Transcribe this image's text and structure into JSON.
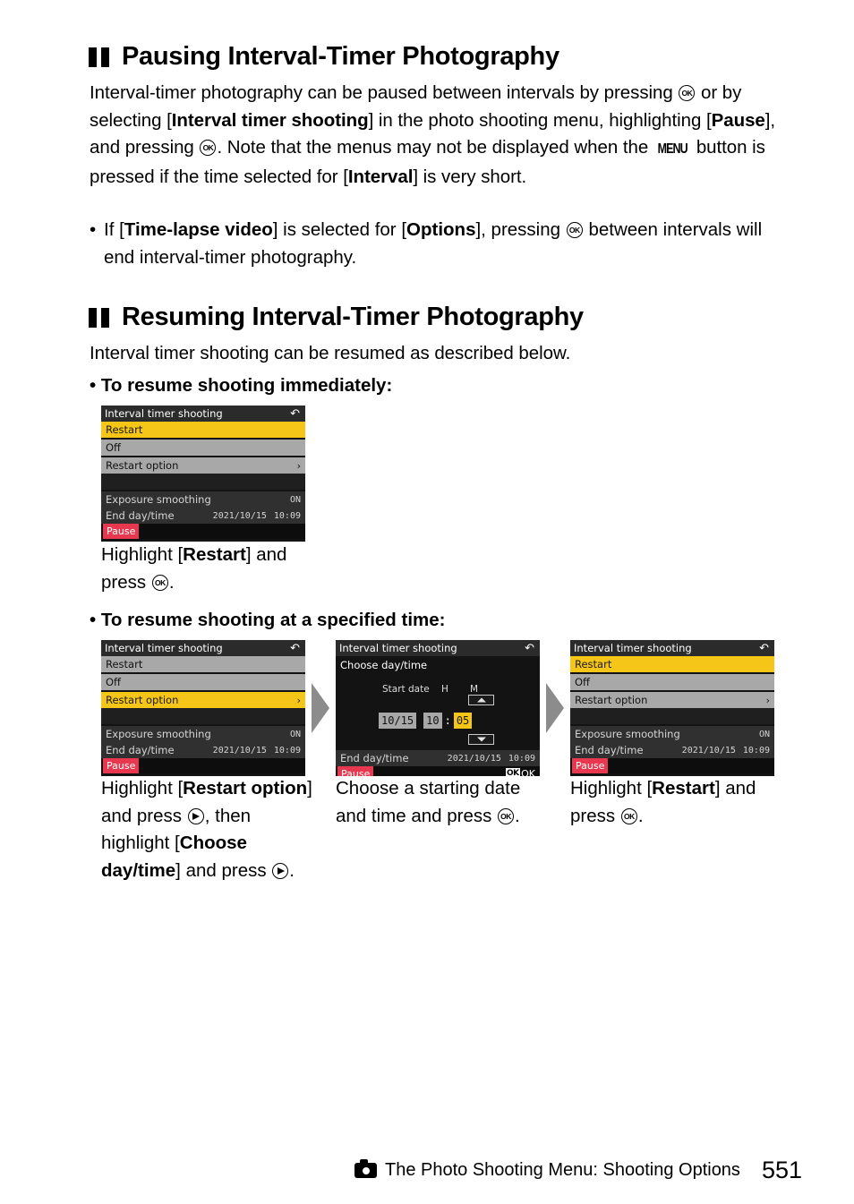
{
  "page": {
    "number": "551",
    "footer_label": "The Photo Shooting Menu: Shooting Options",
    "footer_icon": "camera-icon"
  },
  "sections": [
    {
      "id": "pausing",
      "heading": "Pausing Interval-Timer Photography",
      "heading_icon": "pause-bars-icon",
      "paragraph": {
        "p1": "Interval-timer photography can be paused between intervals by pressing ",
        "p2": " or by selecting [",
        "b1": "Interval timer shooting",
        "p3": "] in the photo shooting menu, highlighting [",
        "b2": "Pause",
        "p4": "], and pressing ",
        "p5": ". Note that the menus may not be displayed when the ",
        "menu_glyph": "MENU",
        "p6": " button is pressed if the time selected for [",
        "b3": "Interval",
        "p7": "] is very short."
      },
      "bullet": {
        "marker": "•",
        "t1": "If [",
        "b1": "Time-lapse video",
        "t2": "] is selected for [",
        "b2": "Options",
        "t3": "], pressing ",
        "t4": " between intervals will end interval-timer photography."
      }
    },
    {
      "id": "resuming",
      "heading": "Resuming Interval-Timer Photography",
      "heading_icon": "pause-bars-icon",
      "intro": "Interval timer shooting can be resumed as described below.",
      "bullet_head_1": "• To resume shooting immediately:",
      "bullet_head_2": "• To resume shooting at a specified time:"
    }
  ],
  "captions": {
    "immediate": {
      "t1": "Highlight [",
      "b1": "Restart",
      "t2": "] and press ",
      "t3": "."
    },
    "step1": {
      "t1": "Highlight [",
      "b1": "Restart option",
      "t2": "] and press ",
      "t3": ", then highlight [",
      "b2": "Choose day/time",
      "t4": "] and press ",
      "t5": "."
    },
    "step2": {
      "t1": "Choose a starting date and time and press ",
      "t2": "."
    },
    "step3": {
      "t1": "Highlight [",
      "b1": "Restart",
      "t2": "] and press ",
      "t3": "."
    }
  },
  "lcd": {
    "title": "Interval timer shooting",
    "return_icon": "return-arrow-icon",
    "rows": {
      "restart": "Restart",
      "off": "Off",
      "restart_option": "Restart option",
      "chevron": "›"
    },
    "exposure_smoothing_label": "Exposure smoothing",
    "exposure_smoothing_value": "ON",
    "end_day_time_label": "End day/time",
    "end_day_time_date": "2021/10/15",
    "end_day_time_clock": "10:09",
    "pause_chip": "Pause",
    "ok_badge": "OK",
    "ok_label": "OK",
    "daytime": {
      "subtitle": "Choose day/time",
      "label_start_date": "Start date",
      "label_hour": "H",
      "label_minute": "M",
      "value_date": "10/15",
      "value_hour": "10",
      "colon": ":",
      "value_minute": "05",
      "spin_up_icon": "triangle-up-icon",
      "spin_down_icon": "triangle-down-icon"
    }
  },
  "colors": {
    "highlight_yellow": "#f5c518",
    "row_grey": "#a8a8a8",
    "pause_red": "#e8384f",
    "lcd_black": "#131313",
    "arrow_grey": "#8c8c8c"
  }
}
